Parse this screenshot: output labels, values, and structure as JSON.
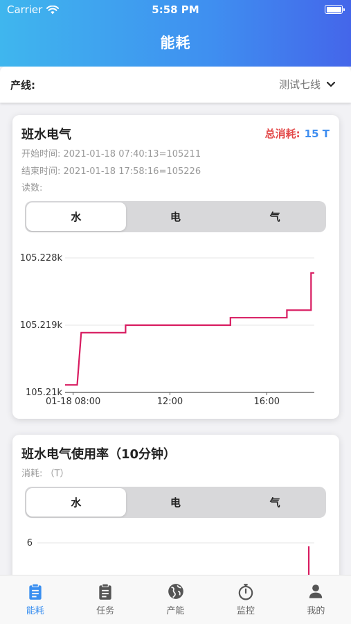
{
  "status": {
    "carrier": "Carrier",
    "time": "5:58 PM"
  },
  "header": {
    "title": "能耗"
  },
  "filter": {
    "label": "产线:",
    "value": "测试七线"
  },
  "card1": {
    "title": "班水电气",
    "total_label": "总消耗:",
    "total_value": "15 T",
    "start": "开始时间: 2021-01-18 07:40:13=105211",
    "end": "结束时间: 2021-01-18 17:58:16=105226",
    "reading": "读数:",
    "tabs": [
      "水",
      "电",
      "气"
    ],
    "active_tab": 0
  },
  "card2": {
    "title": "班水电气使用率（10分钟）",
    "subtitle": "消耗: （T）",
    "tabs": [
      "水",
      "电",
      "气"
    ],
    "active_tab": 0
  },
  "colors": {
    "accent": "#3a8ff0",
    "line": "#d81b60",
    "total_label": "#e34b4b"
  },
  "chart_data": [
    {
      "type": "line",
      "x_ticks": [
        "01-18 08:00",
        "12:00",
        "16:00"
      ],
      "y_ticks": [
        "105.21k",
        "105.219k",
        "105.228k"
      ],
      "ylim": [
        105210,
        105228
      ],
      "grid": true,
      "series": [
        {
          "x": [
            "07:40",
            "08:10",
            "08:10",
            "08:20",
            "08:20",
            "10:10",
            "10:10",
            "14:30",
            "14:30",
            "16:50",
            "16:50",
            "17:50",
            "17:50",
            "17:58"
          ],
          "values": [
            105211,
            105211,
            105211,
            105218,
            105218,
            105218,
            105219,
            105219,
            105220,
            105220,
            105221,
            105221,
            105226,
            105226
          ]
        }
      ]
    },
    {
      "type": "line",
      "y_ticks": [
        "6"
      ],
      "series": [
        {
          "x": [
            "17:50",
            "17:58"
          ],
          "values": [
            0,
            6
          ]
        }
      ]
    }
  ]
}
